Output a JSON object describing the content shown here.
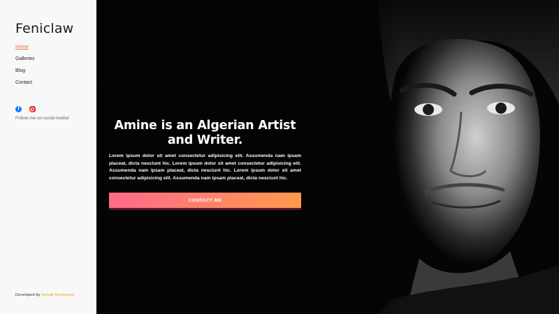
{
  "sidebar": {
    "brand": "Feniclaw",
    "nav": [
      {
        "label": "Home",
        "active": true
      },
      {
        "label": "Galleries",
        "active": false
      },
      {
        "label": "Blog",
        "active": false
      },
      {
        "label": "Contact",
        "active": false
      }
    ],
    "social": {
      "icons": [
        "facebook-icon",
        "instagram-icon"
      ],
      "note": "Follow me on social media!"
    },
    "credit": {
      "prefix": "Developed by",
      "author": "Sohaib Benhsaind"
    }
  },
  "hero": {
    "title": "Amine is an Algerian Artist and Writer.",
    "body": "Lorem ipsum dolor sit amet consectetur adipisicing elit. Assumenda nam ipsam placeat, dicta nesciunt hic. Lorem ipsum dolor sit amet consectetur adipisicing elit. Assumenda nam ipsam placeat, dicta nesciunt hic. Lorem ipsum dolor sit amet consectetur adipisicing elit. Assumenda nam ipsam placeat, dicta nesciunt hic.",
    "cta_label": "CONTACT ME"
  },
  "colors": {
    "accent": "#f06a4c",
    "credit_author": "#f0a020",
    "cta_gradient_start": "#ff6a8a",
    "cta_gradient_end": "#ff9a4e",
    "hero_bg": "#040404",
    "sidebar_bg": "#f8f8f8"
  }
}
